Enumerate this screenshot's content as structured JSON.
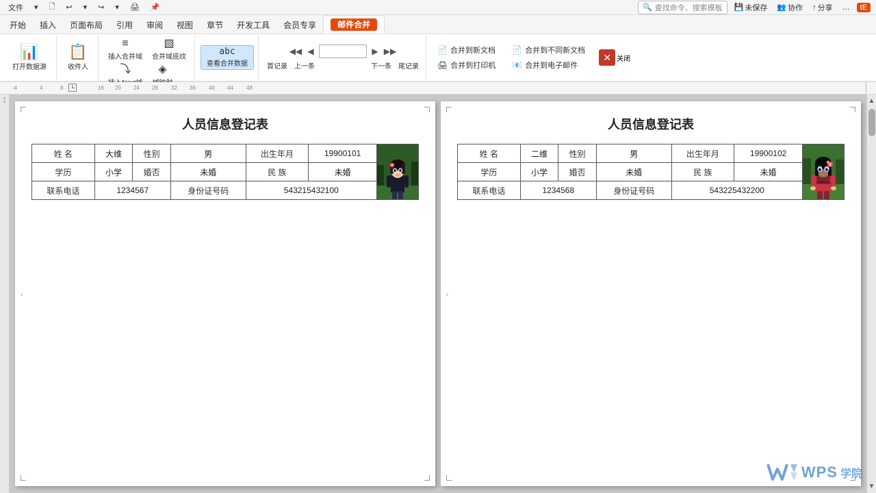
{
  "titlebar": {
    "menu_label": "文件",
    "menu_arrow": "▾",
    "undo": "↩",
    "redo": "↪",
    "save_label": "未保存",
    "collab_label": "协作",
    "share_label": "分享",
    "more_label": "…",
    "search_placeholder": "查找命令、搜索模板",
    "user_initials": "tE"
  },
  "ribbontabs": {
    "tabs": [
      "开始",
      "插入",
      "页面布局",
      "引用",
      "审阅",
      "视图",
      "章节",
      "开发工具",
      "会员专享",
      "邮件合并"
    ]
  },
  "toolbar": {
    "groups": [
      {
        "id": "data-source",
        "buttons": [
          {
            "id": "open-data",
            "icon": "📊",
            "label": "打开数据源"
          }
        ]
      },
      {
        "id": "recipients",
        "buttons": [
          {
            "id": "collect",
            "icon": "📋",
            "label": "收件人"
          }
        ]
      },
      {
        "id": "insert-fields",
        "buttons": [
          {
            "id": "insert-merge-field",
            "icon": "≡",
            "label": "插入合并域"
          },
          {
            "id": "insert-next",
            "icon": "⤵",
            "label": "插入Next域"
          },
          {
            "id": "insert-bg",
            "icon": "▧",
            "label": "合并域底纹"
          },
          {
            "id": "insert-map",
            "icon": "◈",
            "label": "域映射"
          }
        ]
      },
      {
        "id": "view-merge",
        "buttons": [
          {
            "id": "view-results",
            "icon": "abc",
            "label": "查看合并数据"
          }
        ]
      },
      {
        "id": "navigation",
        "prev_first": "◀◀",
        "prev": "◀",
        "next": "▶",
        "next_last": "▶▶",
        "first_label": "首记录",
        "prev_label": "上一条",
        "next_label": "下一条",
        "last_label": "尾记录",
        "input_value": ""
      },
      {
        "id": "merge-to",
        "merge_new_doc": "合并到新文档",
        "merge_print": "合并到打印机",
        "merge_new_doc2": "合并到不同新文档",
        "merge_email": "合并到电子邮件",
        "close": "关闭"
      }
    ]
  },
  "ruler": {
    "marks": [
      "-4",
      "4",
      "8",
      "16",
      "20",
      "24",
      "28",
      "32",
      "36",
      "40",
      "44",
      "48"
    ]
  },
  "doc1": {
    "title": "人员信息登记表",
    "rows": [
      [
        {
          "label": "姓 名",
          "value": "大维"
        },
        {
          "label": "性别",
          "value": "男"
        },
        {
          "label": "出生年月",
          "value": "19900101"
        }
      ],
      [
        {
          "label": "学历",
          "value": "小学"
        },
        {
          "label": "婚否",
          "value": "未婚"
        },
        {
          "label": "民 族",
          "value": "未婚"
        }
      ],
      [
        {
          "label": "联系电话",
          "value": "1234567"
        },
        {
          "label": "身份证号码",
          "value": "543215432100"
        }
      ]
    ]
  },
  "doc2": {
    "title": "人员信息登记表",
    "rows": [
      [
        {
          "label": "姓 名",
          "value": "二维"
        },
        {
          "label": "性别",
          "value": "男"
        },
        {
          "label": "出生年月",
          "value": "19900102"
        }
      ],
      [
        {
          "label": "学历",
          "value": "小学"
        },
        {
          "label": "婚否",
          "value": "未婚"
        },
        {
          "label": "民 族",
          "value": "未婚"
        }
      ],
      [
        {
          "label": "联系电话",
          "value": "1234568"
        },
        {
          "label": "身份证号码",
          "value": "543225432200"
        }
      ]
    ]
  },
  "wps": {
    "logo": "W",
    "brand": "WPS",
    "subtitle": "学院"
  }
}
